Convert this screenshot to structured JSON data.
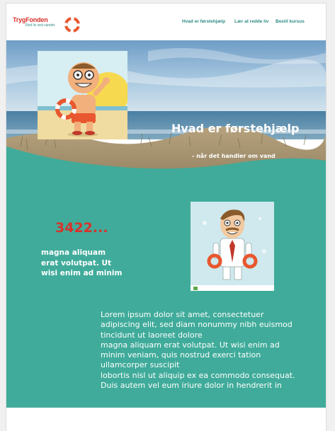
{
  "brand": {
    "name": "TrygFonden",
    "tagline": "Red liv ved vandet",
    "red": "#d8322b",
    "teal": "#40ab9a"
  },
  "nav": {
    "items": [
      {
        "label": "Hvad er førstehjælp"
      },
      {
        "label": "Lær at redde liv"
      },
      {
        "label": "Bestil kursus"
      }
    ]
  },
  "hero": {
    "title": "Hvad er førstehjælp",
    "subtitle": "- når det handler om vand"
  },
  "stat": {
    "value": "3422...",
    "lines": [
      "magna aliquam",
      "erat volutpat. Ut",
      "wisi enim ad minim"
    ]
  },
  "body": {
    "lines": [
      "Lorem ipsum dolor sit amet, consectetuer",
      "adipiscing elit, sed diam nonummy nibh euismod",
      "tincidunt ut laoreet dolore",
      "magna aliquam erat volutpat. Ut wisi enim ad",
      "minim veniam, quis nostrud exerci tation",
      "ullamcorper suscipit",
      "lobortis nisl ut aliquip ex ea commodo consequat.",
      "Duis autem vel eum iriure dolor in hendrerit in"
    ]
  },
  "icons": {
    "logo": "lifebuoy-icon"
  }
}
